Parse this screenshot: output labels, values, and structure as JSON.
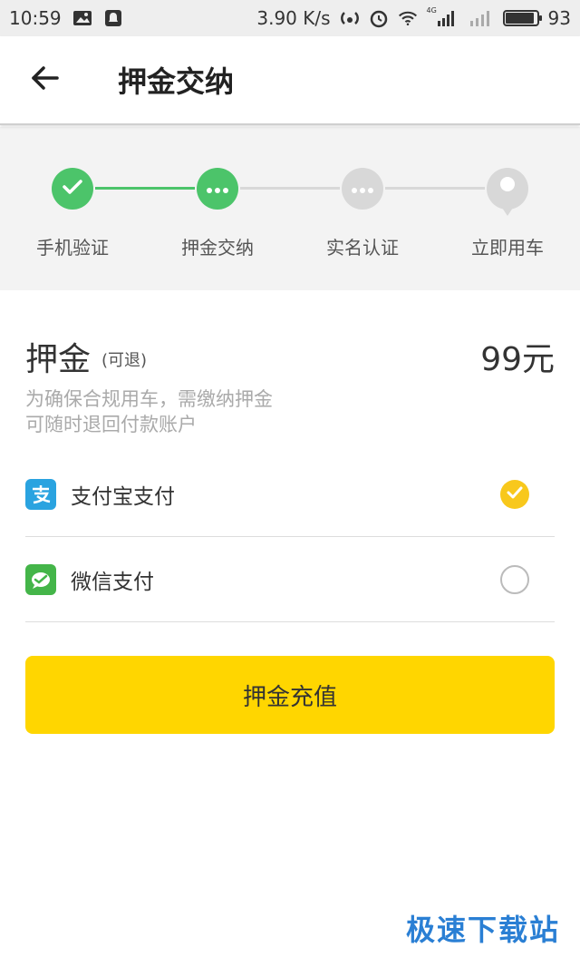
{
  "statusbar": {
    "time": "10:59",
    "network_speed": "3.90 K/s",
    "network_type": "4G",
    "battery": "93",
    "battery_level": 0.93,
    "icons": [
      "image-icon",
      "notification-icon",
      "hotspot-icon",
      "alarm-icon",
      "wifi-icon",
      "signal-icon",
      "signal-weak-icon",
      "battery-icon"
    ]
  },
  "header": {
    "back_icon": "arrow-left-icon",
    "title": "押金交纳"
  },
  "steps": [
    {
      "label": "手机验证",
      "state": "done",
      "icon": "check-icon",
      "color": "#4cc46a"
    },
    {
      "label": "押金交纳",
      "state": "current",
      "icon": "dots-icon",
      "color": "#4cc46a"
    },
    {
      "label": "实名认证",
      "state": "pending",
      "icon": "dots-icon",
      "color": "#d8d8d8"
    },
    {
      "label": "立即用车",
      "state": "pending",
      "icon": "location-pin-icon",
      "color": "#d8d8d8"
    }
  ],
  "colors": {
    "step_done": "#4cc46a",
    "step_pending": "#d8d8d8",
    "accent_yellow": "#ffd600",
    "alipay_blue": "#2aa3e0",
    "wechat_green": "#44b549"
  },
  "deposit": {
    "title": "押金",
    "subtitle": "(可退)",
    "amount": "99元",
    "description_line1": "为确保合规用车，需缴纳押金",
    "description_line2": "可随时退回付款账户"
  },
  "payment_methods": [
    {
      "label": "支付宝支付",
      "icon": "alipay-icon",
      "selected": true
    },
    {
      "label": "微信支付",
      "icon": "wechat-pay-icon",
      "selected": false
    }
  ],
  "submit_button": {
    "label": "押金充值"
  },
  "watermark": "极速下载站"
}
